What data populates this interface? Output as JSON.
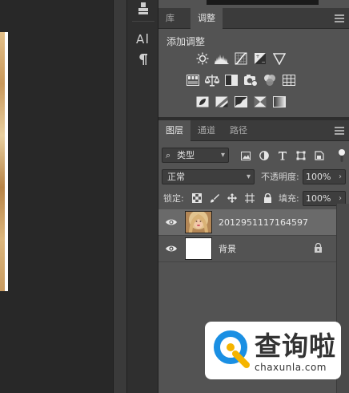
{
  "adjustments_panel": {
    "tabs": [
      {
        "label": "库",
        "active": false
      },
      {
        "label": "调整",
        "active": true
      }
    ],
    "title": "添加调整",
    "icon_rows": [
      [
        "brightness-contrast-icon",
        "levels-icon",
        "curves-icon",
        "exposure-icon",
        "vibrance-icon"
      ],
      [
        "hue-saturation-icon",
        "color-balance-icon",
        "black-white-icon",
        "photo-filter-icon",
        "channel-mixer-icon",
        "color-lookup-icon"
      ],
      [
        "invert-icon",
        "posterize-icon",
        "threshold-icon",
        "selective-color-icon",
        "gradient-map-icon"
      ]
    ]
  },
  "layers_panel": {
    "tabs": [
      {
        "label": "图层",
        "active": true
      },
      {
        "label": "通道",
        "active": false
      },
      {
        "label": "路径",
        "active": false
      }
    ],
    "filter": {
      "label": "类型"
    },
    "blend_mode": "正常",
    "opacity": {
      "label": "不透明度:",
      "value": "100%"
    },
    "lock_label": "锁定:",
    "fill": {
      "label": "填充:",
      "value": "100%"
    },
    "layers": [
      {
        "name": "2012951117164597",
        "selected": true,
        "locked": false,
        "thumbnail": "portrait"
      },
      {
        "name": "背景",
        "selected": false,
        "locked": true,
        "thumbnail": "white"
      }
    ]
  },
  "watermark": {
    "text_cn": "查询啦",
    "url": "chaxunla.com"
  },
  "colors": {
    "panel_bg": "#535353",
    "tabbar_bg": "#3b3b3b",
    "selected_layer": "#6a6a6a",
    "watermark_blue": "#1a8fe3",
    "watermark_yellow": "#f5b400"
  }
}
